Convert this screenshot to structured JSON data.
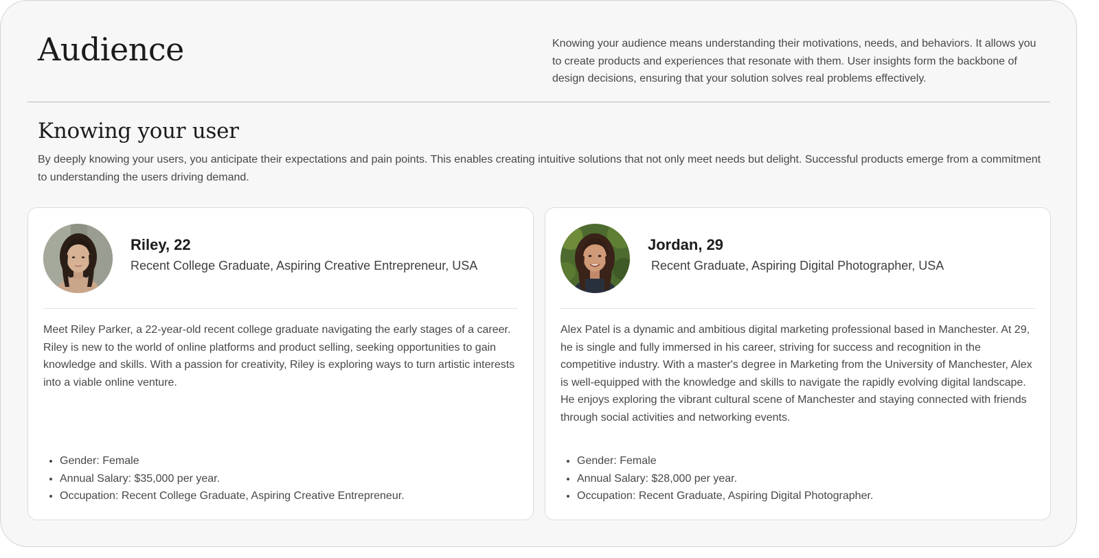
{
  "header": {
    "title": "Audience",
    "intro": "Knowing your audience means understanding their motivations, needs, and behaviors. It allows you to create products and experiences that resonate with them. User insights form the backbone of design decisions, ensuring that your solution solves real problems effectively."
  },
  "section": {
    "title": "Knowing your user",
    "description": "By deeply knowing your users, you anticipate their expectations and pain points. This enables creating intuitive solutions that not only meet needs but delight. Successful products emerge from a commitment to understanding the users driving demand."
  },
  "personas": [
    {
      "name": "Riley, 22",
      "role": "Recent College Graduate, Aspiring Creative Entrepreneur, USA",
      "bio": "Meet Riley Parker, a 22-year-old recent college graduate navigating the early stages of a career. Riley is new to the world of online platforms and product selling, seeking opportunities to gain knowledge and skills. With a passion for creativity, Riley is exploring ways to turn artistic interests into a viable online venture.",
      "facts": [
        "Gender: Female",
        "Annual Salary: $35,000 per year.",
        "Occupation: Recent College Graduate, Aspiring Creative Entrepreneur."
      ]
    },
    {
      "name": "Jordan, 29",
      "role": "Recent Graduate, Aspiring Digital Photographer, USA",
      "bio": "Alex Patel is a dynamic and ambitious digital marketing professional based in Manchester. At 29, he is single and fully immersed in his career, striving for success and recognition in the competitive industry. With a master's degree in Marketing from the University of Manchester, Alex is well-equipped with the knowledge and skills to navigate the rapidly evolving digital landscape. He enjoys exploring the vibrant cultural scene of Manchester and staying connected with friends through social activities and networking events.",
      "facts": [
        "Gender: Female",
        "Annual Salary: $28,000 per year.",
        "Occupation: Recent Graduate, Aspiring Digital Photographer."
      ]
    }
  ],
  "colors": {
    "background": "#f7f7f7",
    "card": "#ffffff",
    "heading": "#1b1b1b",
    "body_text": "#474747"
  }
}
